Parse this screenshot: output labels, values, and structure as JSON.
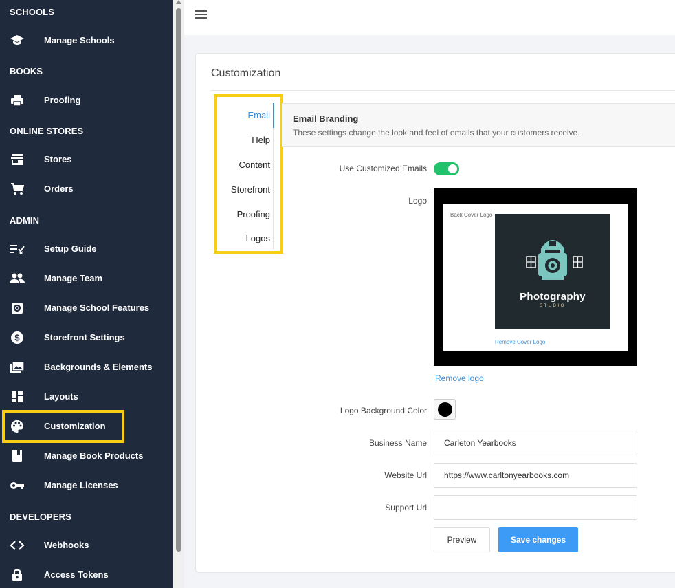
{
  "sidebar": {
    "sections": [
      {
        "title": "SCHOOLS"
      },
      {
        "title": "BOOKS"
      },
      {
        "title": "ONLINE STORES"
      },
      {
        "title": "ADMIN"
      },
      {
        "title": "DEVELOPERS"
      }
    ],
    "items": [
      {
        "label": "Manage Schools",
        "icon": "school-icon"
      },
      {
        "label": "Proofing",
        "icon": "printer-icon"
      },
      {
        "label": "Stores",
        "icon": "store-icon"
      },
      {
        "label": "Orders",
        "icon": "cart-icon"
      },
      {
        "label": "Setup Guide",
        "icon": "checklist-icon"
      },
      {
        "label": "Manage Team",
        "icon": "people-icon"
      },
      {
        "label": "Manage School Features",
        "icon": "settings-box-icon"
      },
      {
        "label": "Storefront Settings",
        "icon": "dollar-icon"
      },
      {
        "label": "Backgrounds & Elements",
        "icon": "images-icon"
      },
      {
        "label": "Layouts",
        "icon": "dashboard-icon"
      },
      {
        "label": "Customization",
        "icon": "palette-icon",
        "highlighted": true
      },
      {
        "label": "Manage Book Products",
        "icon": "book-icon"
      },
      {
        "label": "Manage Licenses",
        "icon": "key-icon"
      },
      {
        "label": "Webhooks",
        "icon": "code-icon"
      },
      {
        "label": "Access Tokens",
        "icon": "lock-icon"
      }
    ]
  },
  "card": {
    "title": "Customization"
  },
  "tabs": [
    {
      "label": "Email",
      "active": true
    },
    {
      "label": "Help"
    },
    {
      "label": "Content"
    },
    {
      "label": "Storefront"
    },
    {
      "label": "Proofing"
    },
    {
      "label": "Logos"
    }
  ],
  "panel": {
    "title": "Email Branding",
    "description": "These settings change the look and feel of emails that your customers receive."
  },
  "form": {
    "use_custom_label": "Use Customized Emails",
    "use_custom_value": true,
    "logo_label": "Logo",
    "logo_preview": {
      "back_cover_label": "Back Cover Logo",
      "brand_title": "Photography",
      "brand_subtitle": "STUDIO",
      "remove_cover_label": "Remove Cover Logo"
    },
    "remove_logo_label": "Remove logo",
    "bg_color_label": "Logo Background Color",
    "bg_color_value": "#000000",
    "business_name_label": "Business Name",
    "business_name_value": "Carleton Yearbooks",
    "website_url_label": "Website Url",
    "website_url_value": "https://www.carltonyearbooks.com",
    "support_url_label": "Support Url",
    "support_url_value": "",
    "preview_label": "Preview",
    "save_label": "Save changes"
  },
  "colors": {
    "sidebar_bg": "#1f2a3d",
    "highlight": "#f7cd16",
    "accent": "#3a8fd9",
    "toggle_on": "#21c26b",
    "save_button": "#3d9bf5"
  }
}
